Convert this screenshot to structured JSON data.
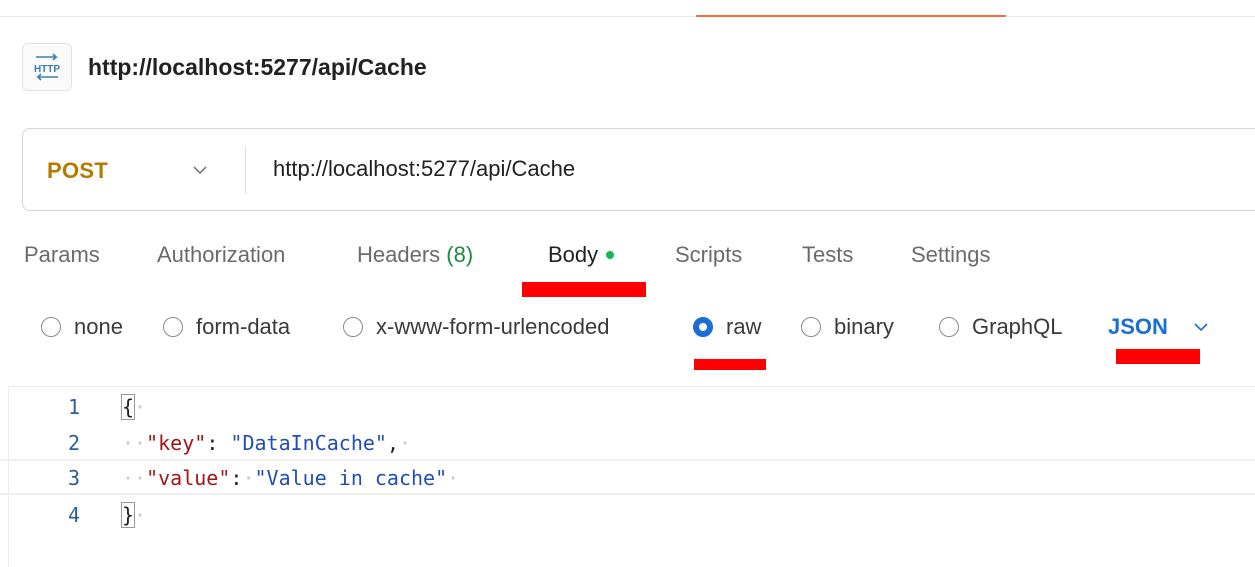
{
  "request": {
    "badge_icon": "http-file-icon",
    "badge_text": "HTTP",
    "title": "http://localhost:5277/api/Cache",
    "method": "POST",
    "url": "http://localhost:5277/api/Cache"
  },
  "tabs": [
    {
      "label": "Params"
    },
    {
      "label": "Authorization"
    },
    {
      "label": "Headers",
      "count": "(8)"
    },
    {
      "label": "Body",
      "active": true,
      "indicator": "green-dot"
    },
    {
      "label": "Scripts"
    },
    {
      "label": "Tests"
    },
    {
      "label": "Settings"
    }
  ],
  "body_types": {
    "options": [
      "none",
      "form-data",
      "x-www-form-urlencoded",
      "raw",
      "binary",
      "GraphQL"
    ],
    "selected": "raw",
    "format": "JSON"
  },
  "editor": {
    "lines": [
      {
        "number": "1",
        "text": "{"
      },
      {
        "number": "2",
        "key": "\"key\"",
        "value": "\"DataInCache\""
      },
      {
        "number": "3",
        "key": "\"value\"",
        "value": "\"Value in cache\""
      },
      {
        "number": "4",
        "text": "}"
      }
    ]
  },
  "colors": {
    "method": "#b47b00",
    "accent_blue": "#1a6ed8",
    "top_accent": "#ff6c37",
    "annotation_red": "#ff0000",
    "body_dot": "#0cbb52"
  }
}
